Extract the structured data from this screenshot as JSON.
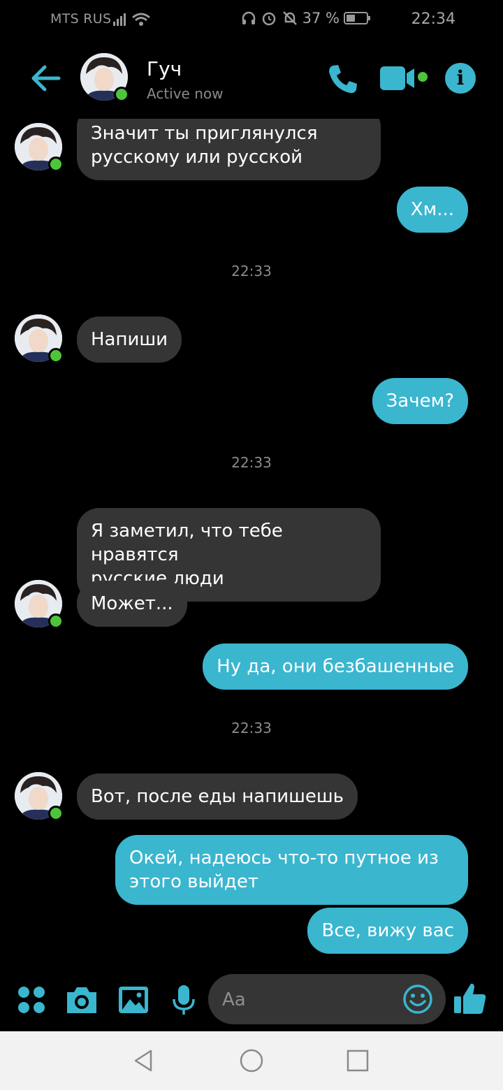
{
  "status_bar": {
    "carrier": "MTS RUS",
    "battery": "37 %",
    "time": "22:34"
  },
  "header": {
    "contact_name": "Гуч",
    "contact_status": "Active now",
    "info_glyph": "i"
  },
  "messages": [
    {
      "dir": "in",
      "text": "Значит ты приглянулся\nрусскому или русской"
    },
    {
      "dir": "out",
      "text": "Хм..."
    },
    {
      "type": "time",
      "text": "22:33"
    },
    {
      "dir": "in",
      "text": "Напиши"
    },
    {
      "dir": "out",
      "text": "Зачем?"
    },
    {
      "type": "time",
      "text": "22:33"
    },
    {
      "dir": "in",
      "text": "Я заметил, что тебе нравятся\nрусские люди"
    },
    {
      "dir": "in",
      "text": "Может..."
    },
    {
      "dir": "out",
      "text": "Ну да, они безбашенные"
    },
    {
      "type": "time",
      "text": "22:33"
    },
    {
      "dir": "in",
      "text": "Вот, после еды напишешь"
    },
    {
      "dir": "out",
      "text": "Окей, надеюсь что-то путное из\nэтого выйдет"
    },
    {
      "dir": "out",
      "text": "Все, вижу вас"
    }
  ],
  "composer": {
    "placeholder": "Aa",
    "icons": [
      "apps-icon",
      "camera-icon",
      "gallery-icon",
      "microphone-icon",
      "emoji-icon",
      "like-icon"
    ]
  },
  "colors": {
    "accent": "#3ab6cf",
    "incoming_bubble": "#353535",
    "online": "#4cc53a"
  }
}
